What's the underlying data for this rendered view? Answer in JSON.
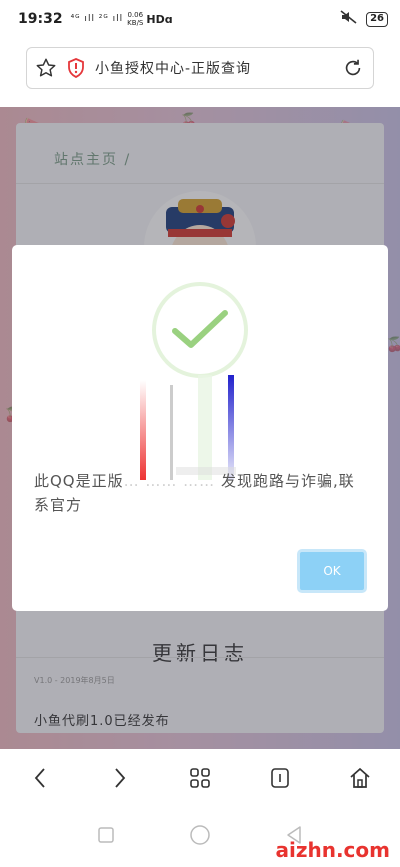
{
  "status_bar": {
    "time": "19:32",
    "network": "⁴ᴳ ıll ²ᴳ ıll",
    "speed_top": "0.06",
    "speed_bottom": "KB/S",
    "hd": "HDɑ",
    "battery": "26"
  },
  "address_bar": {
    "url_text": "小鱼授权中心-正版查询"
  },
  "page": {
    "breadcrumb": "站点主页 /",
    "update_title": "更新日志",
    "update_date": "V1.0 - 2019年8月5日",
    "update_text": "小鱼代刷1.0已经发布"
  },
  "modal": {
    "message_prefix": "此QQ是正版",
    "message_suffix": "发现跑路与诈骗,联系官方",
    "ok_label": "OK"
  },
  "watermark": "aizhn.com",
  "colors": {
    "check": "#9ad180",
    "ok_button": "#8dd1f6",
    "breadcrumb": "#7a9c86"
  },
  "icons": [
    "star-icon",
    "shield-icon",
    "reload-icon",
    "back-icon",
    "forward-icon",
    "tabs-grid-icon",
    "window-icon",
    "home-icon",
    "square-icon",
    "circle-icon",
    "triangle-icon"
  ]
}
